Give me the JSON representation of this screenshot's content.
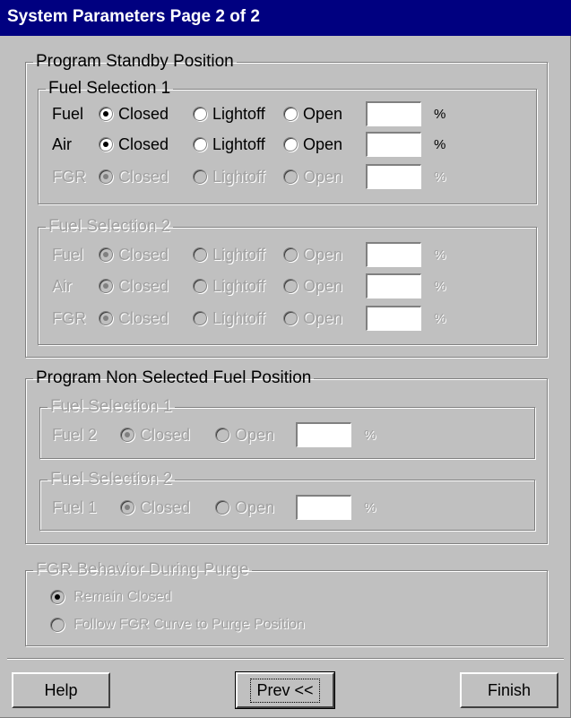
{
  "window": {
    "title": "System Parameters Page 2 of 2"
  },
  "standby": {
    "legend": "Program Standby Position",
    "fuel_sel_1": {
      "legend": "Fuel Selection 1",
      "rows": [
        {
          "label": "Fuel",
          "closed": "Closed",
          "lightoff": "Lightoff",
          "open": "Open",
          "value": "",
          "unit": "%"
        },
        {
          "label": "Air",
          "closed": "Closed",
          "lightoff": "Lightoff",
          "open": "Open",
          "value": "",
          "unit": "%"
        },
        {
          "label": "FGR",
          "closed": "Closed",
          "lightoff": "Lightoff",
          "open": "Open",
          "value": "",
          "unit": "%"
        }
      ]
    },
    "fuel_sel_2": {
      "legend": "Fuel Selection 2",
      "rows": [
        {
          "label": "Fuel",
          "closed": "Closed",
          "lightoff": "Lightoff",
          "open": "Open",
          "value": "",
          "unit": "%"
        },
        {
          "label": "Air",
          "closed": "Closed",
          "lightoff": "Lightoff",
          "open": "Open",
          "value": "",
          "unit": "%"
        },
        {
          "label": "FGR",
          "closed": "Closed",
          "lightoff": "Lightoff",
          "open": "Open",
          "value": "",
          "unit": "%"
        }
      ]
    }
  },
  "non_selected": {
    "legend": "Program Non Selected Fuel Position",
    "fuel_sel_1": {
      "legend": "Fuel Selection 1",
      "label": "Fuel 2",
      "closed": "Closed",
      "open": "Open",
      "value": "",
      "unit": "%"
    },
    "fuel_sel_2": {
      "legend": "Fuel Selection 2",
      "label": "Fuel 1",
      "closed": "Closed",
      "open": "Open",
      "value": "",
      "unit": "%"
    }
  },
  "purge": {
    "legend": "FGR Behavior During Purge",
    "options": [
      "Remain Closed",
      "Follow FGR Curve to Purge Position"
    ]
  },
  "buttons": {
    "help": "Help",
    "prev": "Prev <<",
    "finish": "Finish"
  }
}
